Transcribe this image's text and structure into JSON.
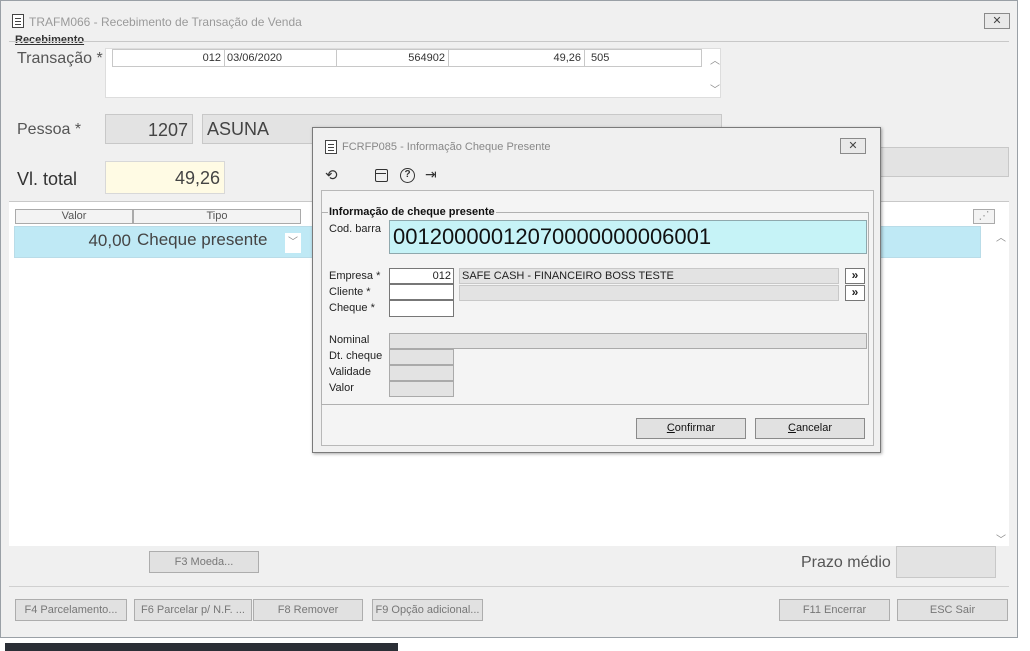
{
  "window": {
    "title": "TRAFM066 - Recebimento de Transação de Venda",
    "close": "✕"
  },
  "group": {
    "label": "Recebimento"
  },
  "transacao": {
    "label": "Transação *",
    "row": [
      "012",
      "03/06/2020",
      "564902",
      "49,26",
      "505"
    ]
  },
  "pessoa": {
    "label": "Pessoa *",
    "code": "1207",
    "name": "ASUNA"
  },
  "total": {
    "label": "Vl. total",
    "value": "49,26"
  },
  "grid": {
    "headers": {
      "valor": "Valor",
      "tipo": "Tipo"
    },
    "row": {
      "valor": "40,00",
      "tipo": "Cheque presente"
    }
  },
  "buttons": {
    "f3": "F3 Moeda...",
    "f4": "F4 Parcelamento...",
    "f6": "F6 Parcelar p/ N.F. ...",
    "f8": "F8 Remover",
    "f9": "F9 Opção adicional...",
    "f11": "F11 Encerrar",
    "esc": "ESC Sair"
  },
  "prazo": {
    "label": "Prazo médio",
    "value": ""
  },
  "dialog": {
    "title": "FCRFP085 - Informação Cheque Presente",
    "close": "✕",
    "group_label": "Informação de cheque presente",
    "cod_barra_label": "Cod. barra",
    "cod_barra_value": "00120000012070000000006001",
    "empresa_label": "Empresa *",
    "empresa_code": "012",
    "empresa_name": "SAFE CASH - FINANCEIRO BOSS TESTE",
    "cliente_label": "Cliente *",
    "cheque_label": "Cheque *",
    "nominal_label": "Nominal",
    "dt_cheque_label": "Dt. cheque",
    "validade_label": "Validade",
    "valor_label": "Valor",
    "nav_symbol": "»",
    "confirm": "Confirmar",
    "cancel": "Cancelar"
  }
}
